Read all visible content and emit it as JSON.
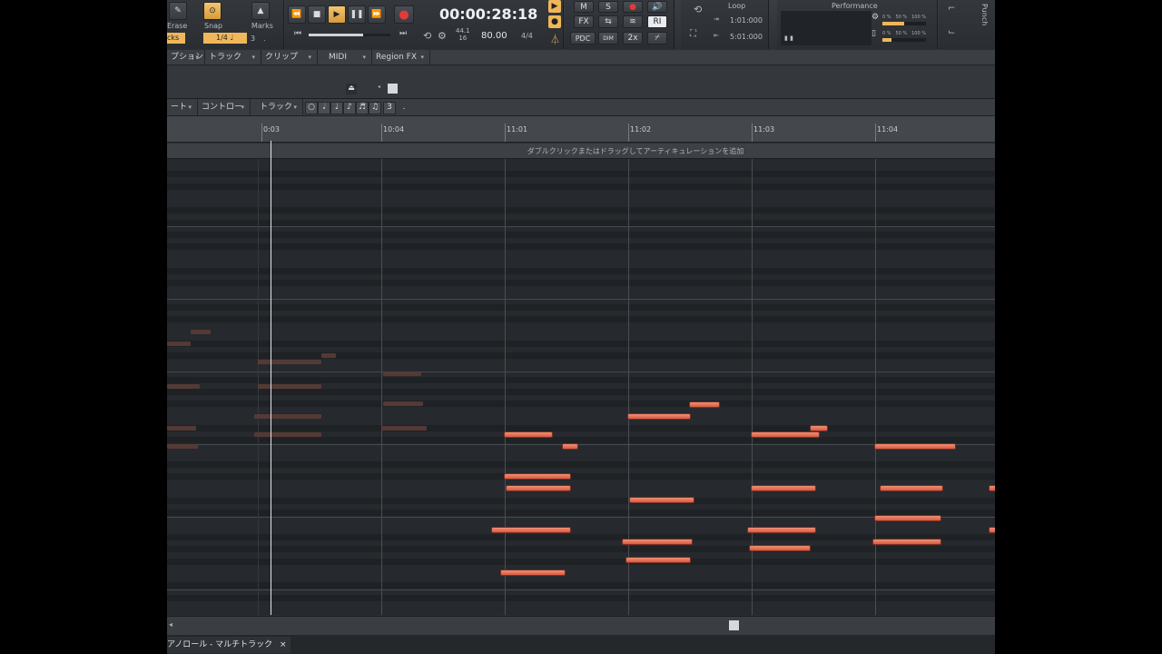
{
  "controlbar": {
    "tools": {
      "erase_label": "Erase",
      "snap_label": "Snap",
      "marks_label": "Marks",
      "tracks_label": "cks",
      "snap_value": "1/4",
      "snap_triplet": "3",
      "snap_dot": "."
    },
    "transport": {
      "time": "00:00:28:18",
      "sample_rate": "44.1",
      "bit_depth": "16",
      "tempo": "80.00",
      "meter": "4/4"
    },
    "mix": {
      "m": "M",
      "s": "S",
      "fx": "FX",
      "pdc": "PDC",
      "ri": "RI",
      "x2": "2x",
      "dim": "DIM"
    },
    "loop": {
      "title": "Loop",
      "start": "1:01:000",
      "end": "5:01:000"
    },
    "performance": {
      "title": "Performance",
      "row1": [
        "0 %",
        "50 %",
        "100 %"
      ],
      "row2": [
        "0 %",
        "50 %",
        "100 %"
      ]
    },
    "punch_label": "Punch"
  },
  "menubar": {
    "items": [
      "プション",
      "トラック",
      "クリップ",
      "MIDI",
      "Region FX"
    ]
  },
  "submenubar": {
    "items": [
      "ート",
      "コントローラ",
      "トラック"
    ],
    "triplet": "3",
    "dot": "."
  },
  "ruler": {
    "ticks": [
      "0:03",
      "10:04",
      "11:01",
      "11:02",
      "11:03",
      "11:04"
    ]
  },
  "articulation_hint": "ダブルクリックまたはドラッグしてアーティキュレーションを追加",
  "tab": {
    "label": "アノロール - マルチトラック",
    "close": "×"
  },
  "colors": {
    "note_active": "#e0684f",
    "note_ghost": "#5a3c36",
    "accent": "#f0b75a",
    "playhead": "#e4e6e9"
  }
}
